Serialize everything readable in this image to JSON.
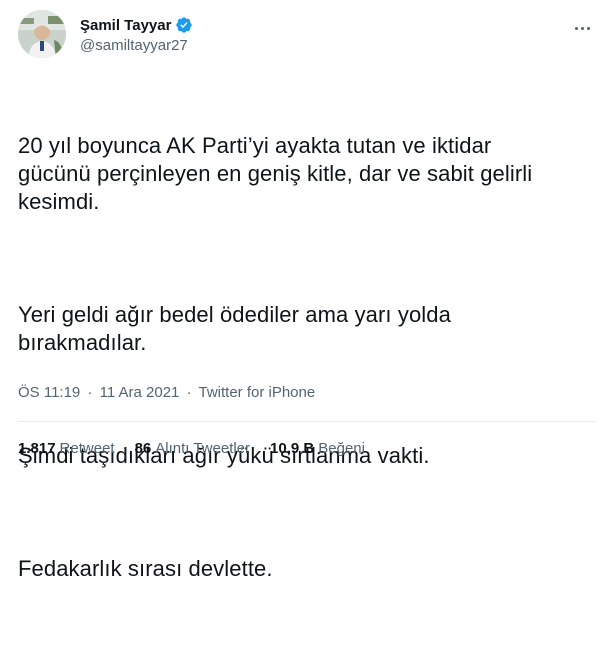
{
  "author": {
    "display_name": "Şamil Tayyar",
    "handle": "@samiltayyar27",
    "verified": true
  },
  "tweet": {
    "paragraphs": [
      "20 yıl boyunca AK Parti’yi ayakta tutan ve iktidar\ngücünü perçinleyen en geniş kitle, dar ve sabit gelirli\nkesimdi.",
      "Yeri geldi ağır bedel ödediler ama yarı yolda\nbırakmadılar.",
      "Şimdi taşıdıkları ağır yükü sırtlanma vakti.",
      "Fedakarlık sırası devlette."
    ],
    "time": "ÖS 11:19",
    "date": "11 Ara 2021",
    "separator": "·",
    "source": "Twitter for iPhone"
  },
  "stats": {
    "retweets_count": "1.817",
    "retweets_label": "Retweet",
    "quotes_count": "86",
    "quotes_label": "Alıntı Tweetler",
    "likes_count": "10,9 B",
    "likes_label": "Beğeni"
  },
  "colors": {
    "verified": "#1d9bf0",
    "text": "#0f1419",
    "secondary": "#536471",
    "divider": "#e6ecf0"
  },
  "icons": {
    "verified": "verified-badge-icon",
    "more": "more-options-icon"
  }
}
